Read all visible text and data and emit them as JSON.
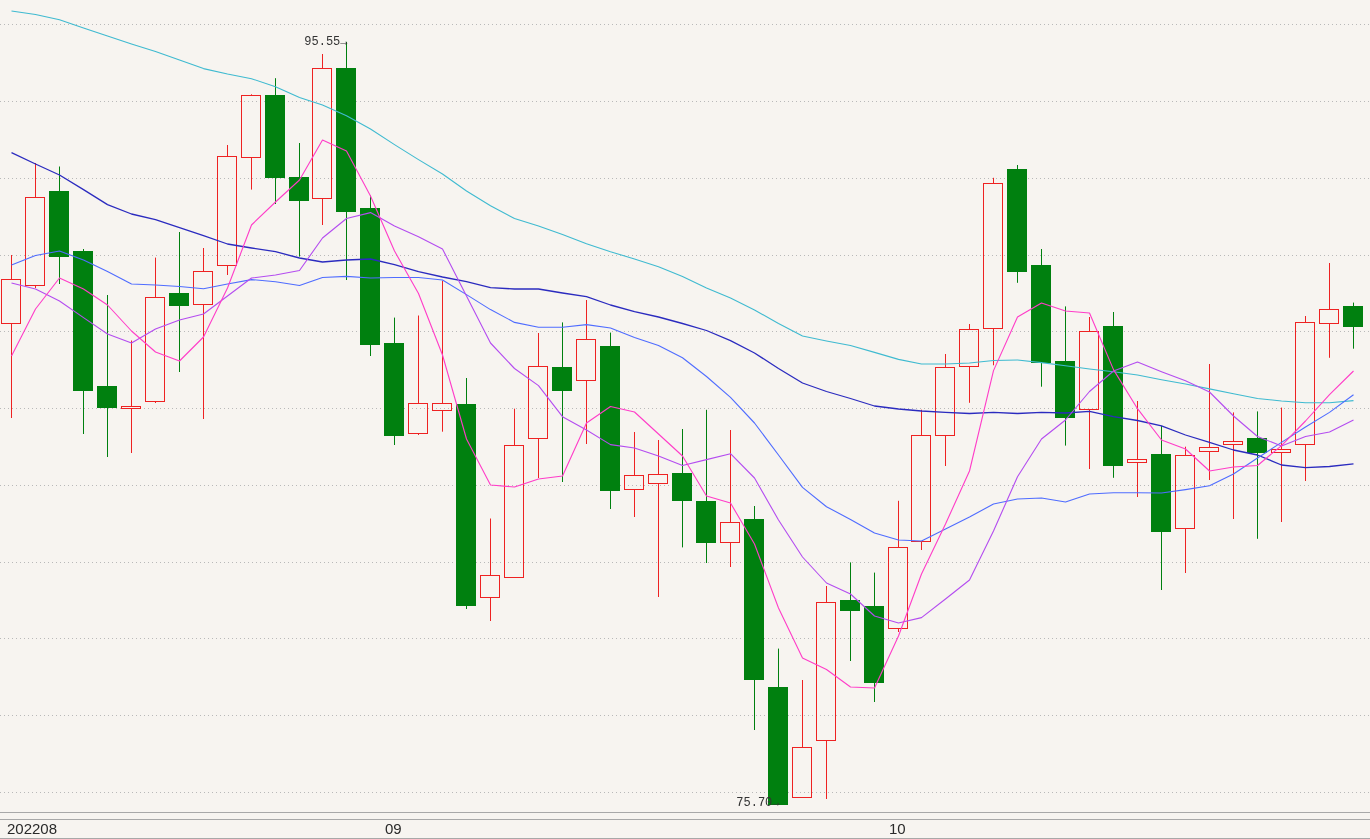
{
  "chart": {
    "price_markers": [
      {
        "kind": "high",
        "text": "95.55→"
      },
      {
        "kind": "low",
        "text": "75.70→"
      }
    ]
  },
  "x_axis": {
    "labels": [
      "202208",
      "09",
      "10"
    ]
  }
}
